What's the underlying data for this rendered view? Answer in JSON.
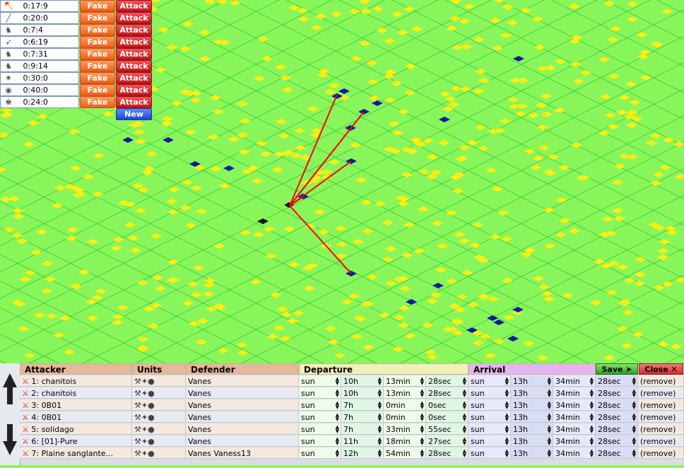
{
  "planner": {
    "rows": [
      {
        "icon": "axe-icon",
        "time": "0:17:9"
      },
      {
        "icon": "spear-icon",
        "time": "0:20:0"
      },
      {
        "icon": "knight-icon",
        "time": "0:7:4"
      },
      {
        "icon": "archer-icon",
        "time": "0:6:19"
      },
      {
        "icon": "knight-icon",
        "time": "0:7:31"
      },
      {
        "icon": "knight-icon",
        "time": "0:9:14"
      },
      {
        "icon": "catapult-icon",
        "time": "0:30:0"
      },
      {
        "icon": "ram-icon",
        "time": "0:40:0"
      },
      {
        "icon": "noble-icon",
        "time": "0:24:0"
      }
    ],
    "fake_label": "Fake",
    "attack_label": "Attack",
    "new_label": "New"
  },
  "table": {
    "headers": {
      "attacker": "Attacker",
      "units": "Units",
      "defender": "Defender",
      "departure": "Departure",
      "arrival": "Arrival"
    },
    "save_label": "Save",
    "close_label": "Close",
    "remove_label": "(remove)",
    "rows": [
      {
        "attacker": "1: chanitois",
        "defender": "Vanes",
        "dep": [
          "sun",
          "10h",
          "13min",
          "28sec"
        ],
        "arr": [
          "sun",
          "13h",
          "34min",
          "28sec"
        ]
      },
      {
        "attacker": "2: chanitois",
        "defender": "Vanes",
        "dep": [
          "sun",
          "10h",
          "13min",
          "28sec"
        ],
        "arr": [
          "sun",
          "13h",
          "34min",
          "28sec"
        ]
      },
      {
        "attacker": "3: 0B01",
        "defender": "Vanes",
        "dep": [
          "sun",
          "7h",
          "0min",
          "0sec"
        ],
        "arr": [
          "sun",
          "13h",
          "34min",
          "28sec"
        ]
      },
      {
        "attacker": "4: 0B01",
        "defender": "Vanes",
        "dep": [
          "sun",
          "7h",
          "0min",
          "0sec"
        ],
        "arr": [
          "sun",
          "13h",
          "34min",
          "28sec"
        ]
      },
      {
        "attacker": "5: solidago",
        "defender": "Vanes",
        "dep": [
          "sun",
          "7h",
          "33min",
          "55sec"
        ],
        "arr": [
          "sun",
          "13h",
          "34min",
          "28sec"
        ]
      },
      {
        "attacker": "6: [01]-Pure",
        "defender": "Vanes",
        "dep": [
          "sun",
          "11h",
          "18min",
          "27sec"
        ],
        "arr": [
          "sun",
          "13h",
          "34min",
          "28sec"
        ]
      },
      {
        "attacker": "7: Plaine sanglante...",
        "defender": "Vanes Vaness13",
        "dep": [
          "sun",
          "12h",
          "54min",
          "28sec"
        ],
        "arr": [
          "sun",
          "13h",
          "34min",
          "28sec"
        ]
      }
    ]
  },
  "colors": {
    "map_bg": "#88f65a",
    "village_yellow": "#ffee11",
    "village_blue": "#0b1a9e",
    "attack_line": "#ff0000",
    "grid_line": "#3fcf3f"
  }
}
